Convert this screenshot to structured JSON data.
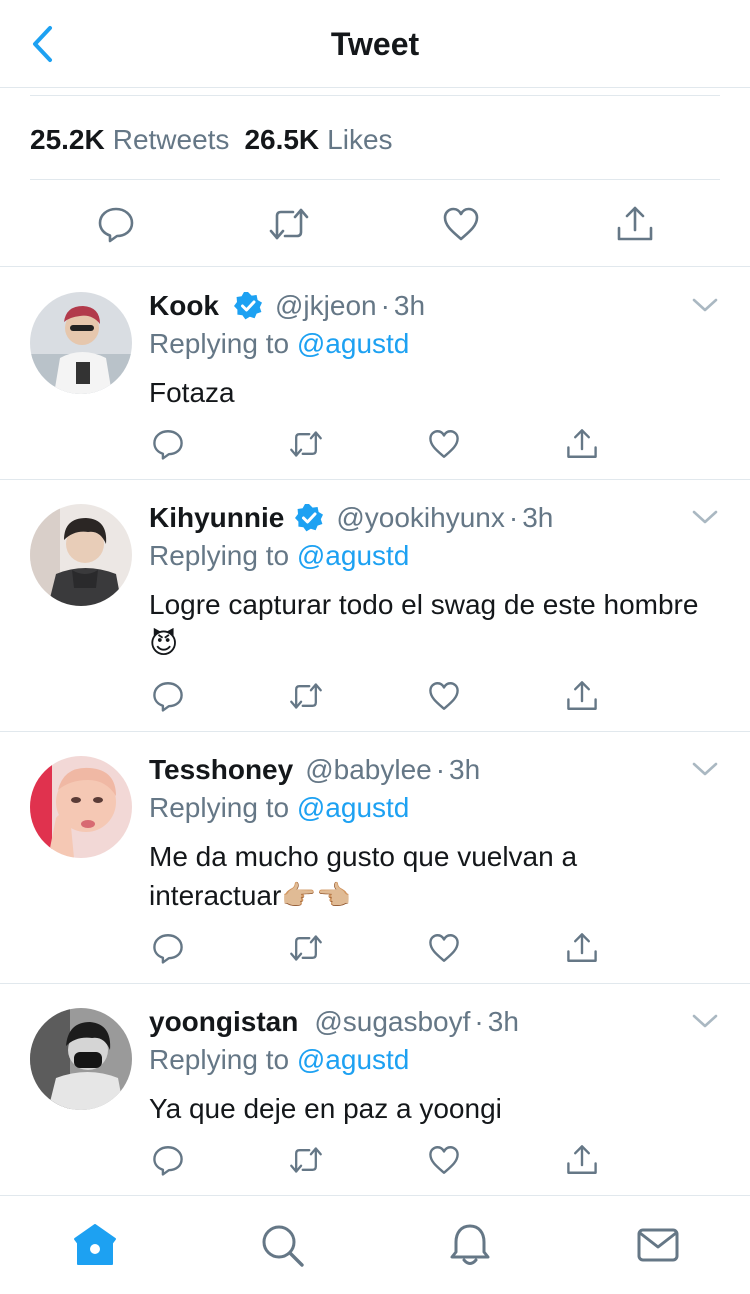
{
  "header": {
    "title": "Tweet"
  },
  "stats": {
    "retweets_count": "25.2K",
    "retweets_label": "Retweets",
    "likes_count": "26.5K",
    "likes_label": "Likes"
  },
  "colors": {
    "accent": "#1da1f2",
    "muted": "#657786",
    "text": "#14171a",
    "divider": "#e1e8ed"
  },
  "replies": [
    {
      "name": "Kook",
      "verified": true,
      "handle": "@jkjeon",
      "sep": "·",
      "time": "3h",
      "replying_label": "Replying to",
      "mention": "@agustd",
      "text": "Fotaza"
    },
    {
      "name": "Kihyunnie",
      "verified": true,
      "handle": "@yookihyunx",
      "sep": "·",
      "time": "3h",
      "replying_label": "Replying to",
      "mention": "@agustd",
      "text": "Logre capturar todo el swag de este hombre 😈"
    },
    {
      "name": "Tesshoney",
      "verified": false,
      "handle": "@babylee",
      "sep": "·",
      "time": "3h",
      "replying_label": "Replying to",
      "mention": "@agustd",
      "text": "Me da mucho gusto que vuelvan a interactuar👉🏼👈🏼"
    },
    {
      "name": "yoongistan",
      "verified": false,
      "handle": "@sugasboyf",
      "sep": "·",
      "time": "3h",
      "replying_label": "Replying to",
      "mention": "@agustd",
      "text": "Ya que deje en paz a yoongi"
    }
  ],
  "tabbar": {
    "items": [
      "home-icon",
      "search-icon",
      "notifications-icon",
      "messages-icon"
    ],
    "active": "home-icon"
  }
}
